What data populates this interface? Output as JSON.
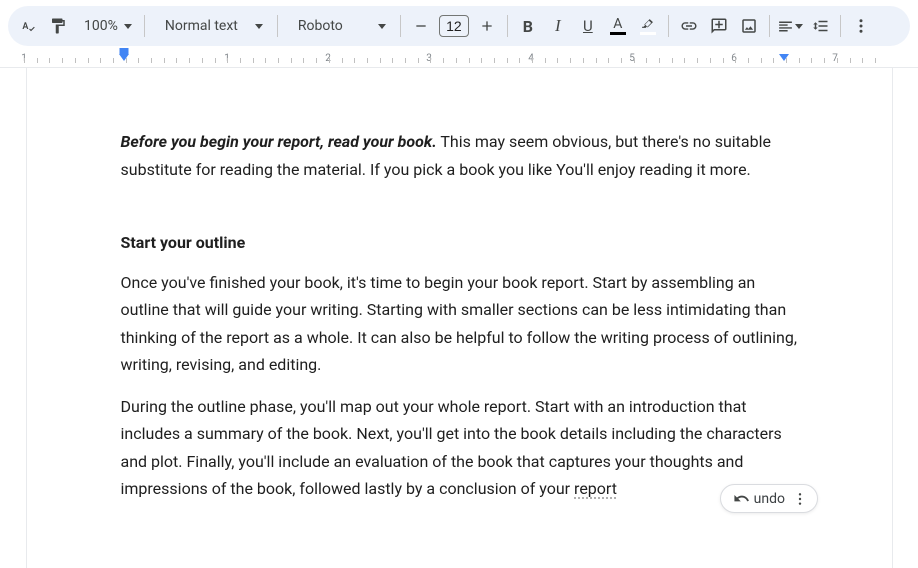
{
  "toolbar": {
    "zoom": "100%",
    "style": "Normal text",
    "font": "Roboto",
    "fontsize": "12",
    "bold": "B",
    "italic": "I",
    "underline": "U",
    "text_color_letter": "A"
  },
  "ruler": {
    "numbers": [
      "1",
      "1",
      "2",
      "3",
      "4",
      "5",
      "6",
      "7"
    ]
  },
  "document": {
    "p1_lead": "Before you begin your report, read your book.",
    "p1_rest": " This may seem obvious, but there's no suitable substitute for reading the material. If you pick a book you like You'll enjoy reading it more.",
    "h2": "Start your outline",
    "p2": "Once you've finished your book, it's time to begin your book report. Start by assembling an outline that will guide your writing. Starting with smaller sections can be less intimidating than thinking of the report as a whole. It can also be helpful to follow the writing process of outlining, writing, revising, and editing.",
    "p3a": "During the outline phase, you'll map out your whole report. Start with an introduction that includes a summary of the book. Next, you'll get into the book details including the characters and plot. Finally, you'll include an evaluation of the book that captures your thoughts and impressions of the book, followed lastly by a conclusion of your ",
    "p3b": "report"
  },
  "undo": {
    "label": "undo"
  }
}
